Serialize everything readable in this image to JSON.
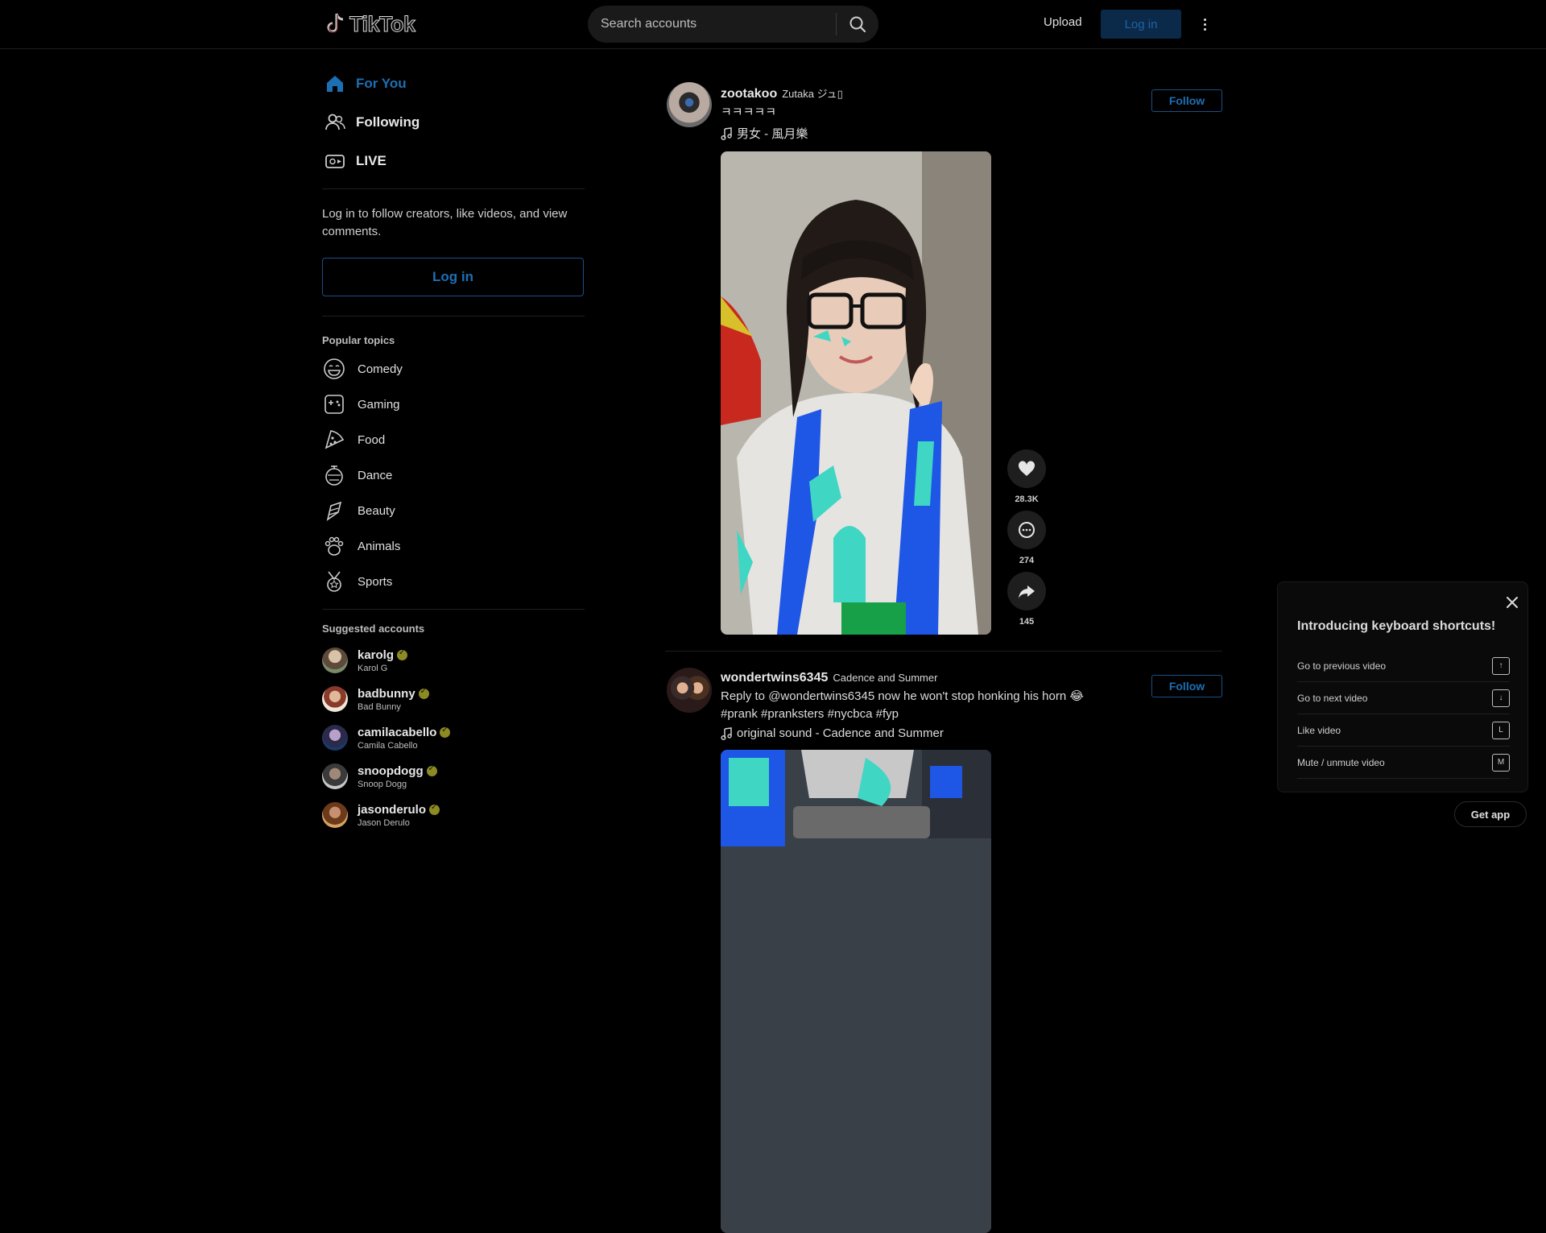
{
  "header": {
    "logo_text": "TikTok",
    "search_placeholder": "Search accounts",
    "upload_label": "Upload",
    "login_label": "Log in"
  },
  "sidebar": {
    "nav": [
      {
        "label": "For You",
        "icon": "home-icon",
        "active": true
      },
      {
        "label": "Following",
        "icon": "users-icon",
        "active": false
      },
      {
        "label": "LIVE",
        "icon": "live-icon",
        "active": false
      }
    ],
    "login_prompt": "Log in to follow creators, like videos, and view comments.",
    "login_button": "Log in",
    "popular_topics_title": "Popular topics",
    "topics": [
      {
        "label": "Comedy",
        "icon": "comedy-icon"
      },
      {
        "label": "Gaming",
        "icon": "gaming-icon"
      },
      {
        "label": "Food",
        "icon": "food-icon"
      },
      {
        "label": "Dance",
        "icon": "dance-icon"
      },
      {
        "label": "Beauty",
        "icon": "beauty-icon"
      },
      {
        "label": "Animals",
        "icon": "animals-icon"
      },
      {
        "label": "Sports",
        "icon": "sports-icon"
      }
    ],
    "suggested_title": "Suggested accounts",
    "accounts": [
      {
        "handle": "karolg",
        "name": "Karol G",
        "verified": true
      },
      {
        "handle": "badbunny",
        "name": "Bad Bunny",
        "verified": true
      },
      {
        "handle": "camilacabello",
        "name": "Camila Cabello",
        "verified": true
      },
      {
        "handle": "snoopdogg",
        "name": "Snoop Dogg",
        "verified": true
      },
      {
        "handle": "jasonderulo",
        "name": "Jason Derulo",
        "verified": true
      }
    ]
  },
  "feed": {
    "posts": [
      {
        "handle": "zootakoo",
        "display_name": "Zutaka ジュ▯",
        "description": "ㅋㅋㅋㅋㅋ",
        "music": "男女 - 風月樂",
        "follow_label": "Follow",
        "likes": "28.3K",
        "comments": "274",
        "shares": "145"
      },
      {
        "handle": "wondertwins6345",
        "display_name": "Cadence and Summer",
        "description": "Reply to @wondertwins6345 now he won't stop honking his horn 😂 #prank #pranksters #nycbca #fyp",
        "music": "original sound - Cadence and Summer",
        "follow_label": "Follow"
      }
    ]
  },
  "shortcuts": {
    "title": "Introducing keyboard shortcuts!",
    "items": [
      {
        "label": "Go to previous video",
        "key": "↑"
      },
      {
        "label": "Go to next video",
        "key": "↓"
      },
      {
        "label": "Like video",
        "key": "L"
      },
      {
        "label": "Mute / unmute video",
        "key": "M"
      }
    ]
  },
  "get_app_label": "Get app",
  "colors": {
    "accent_blue": "#1d6fb5",
    "login_button_bg": "#0b2a4a",
    "background": "#000000",
    "verified_badge": "#8c8a22"
  }
}
